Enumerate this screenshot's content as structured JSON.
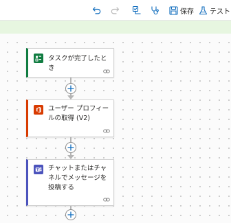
{
  "toolbar": {
    "save_label": "保存",
    "test_label": "テスト",
    "icons": [
      "undo-icon",
      "redo-icon",
      "flow-checker-icon",
      "health-icon",
      "save-icon",
      "flask-icon"
    ]
  },
  "flow": {
    "steps": [
      {
        "title": "タスクが完了したとき",
        "icon": "planner-icon",
        "accent": "#107c41"
      },
      {
        "title": "ユーザー プロフィールの取得 (V2)",
        "icon": "office-icon",
        "accent": "#d83b01"
      },
      {
        "title": "チャットまたはチャネルでメッセージを投稿する",
        "icon": "teams-icon",
        "accent": "#4b53bc"
      }
    ]
  },
  "colors": {
    "banner": "#e7f6e0",
    "toolbar_icon": "#0f6cbd",
    "connector": "#b4b4b4"
  }
}
